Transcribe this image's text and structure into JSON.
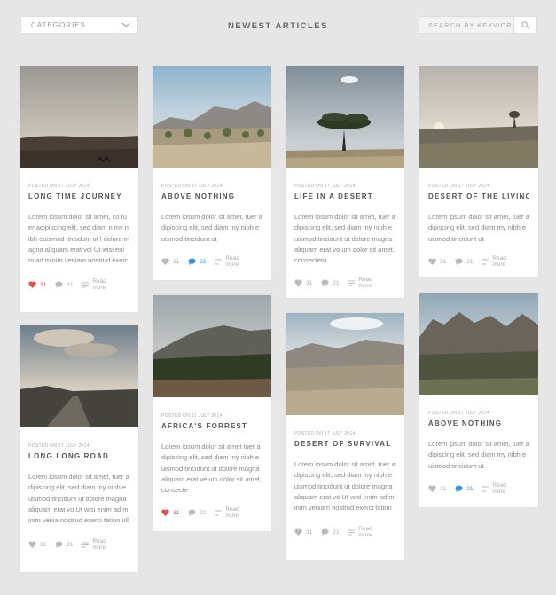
{
  "header": {
    "categories_label": "CATEGORIES",
    "title": "NEWEST ARTICLES",
    "search_placeholder": "SEARCH BY KEYWORDS"
  },
  "cards": [
    {
      "posted": "POSTED ON 17 JULY 2014",
      "title": "LONG TIME JOURNEY",
      "excerpt": "Lorem ipsum dolor sit amet, co tuer adipiscing elit, sed diam n my nibh euismod tincidunt ut l dolore magna aliquam erat vol Ut wisi enim ad minim veniam nostrud exerci tation ullamcor",
      "likes": "31",
      "comments": "21",
      "read_more": "Read more",
      "liked": true,
      "commented": false
    },
    {
      "posted": "POSTED ON 17 JULY 2014",
      "title": "ABOVE NOTHING",
      "excerpt": "Lorem ipsum dolor sit amet, tuer adipiscing elit, sed diam my nibh euismod tincidunt ut",
      "likes": "31",
      "comments": "21",
      "read_more": "Read more",
      "liked": false,
      "commented": true
    },
    {
      "posted": "POSTED ON 17 JULY 2014",
      "title": "LIFE IN A DESERT",
      "excerpt": "Lorem ipsum dolor sit amet, tuer adipiscing elit, sed diam my nibh euismod tincidunt ut dolore magna aliquam erat vo um dolor sit amet, consectetu",
      "likes": "31",
      "comments": "21",
      "read_more": "Read more",
      "liked": false,
      "commented": false
    },
    {
      "posted": "POSTED ON 17 JULY 2014",
      "title": "DESERT OF THE LIVINGS",
      "excerpt": "Lorem ipsum dolor sit amet, tuer adipiscing elit, sed diam my nibh euismod tincidunt ut",
      "likes": "31",
      "comments": "21",
      "read_more": "Read more",
      "liked": false,
      "commented": false
    },
    {
      "posted": "POSTED ON 17 JULY 2014",
      "title": "LONG LONG ROAD",
      "excerpt": "Lorem ipsum dolor sit amet, tuer adipiscing elit, sed diam my nibh euismod tincidunt ut dolore magna aliquam erat vo Ut wisi enim ad minim venia nostrud exerci tation ullamco",
      "likes": "31",
      "comments": "21",
      "read_more": "Read more",
      "liked": false,
      "commented": false
    },
    {
      "posted": "POSTED ON 17 JULY 2014",
      "title": "AFRICA'S FORREST",
      "excerpt": "Lorem ipsum dolor sit amet tuer adipiscing elit, sed diam my nibh euismod tincidunt ut dolore magna aliquam erat ve um dolor sit amet, consecte",
      "likes": "31",
      "comments": "21",
      "read_more": "Read more",
      "liked": true,
      "commented": false
    },
    {
      "posted": "POSTED ON 17 JULY 2014",
      "title": "DESERT OF SURVIVAL",
      "excerpt": "Lorem ipsum dolor sit amet, tuer adipiscing elit, sed diam my nibh euismod tincidunt ut dolore magna aliquam erat vo Ut wisi enim ad minim veniam nostrud exerci tation ullamco",
      "likes": "31",
      "comments": "21",
      "read_more": "Read more",
      "liked": false,
      "commented": false
    },
    {
      "posted": "POSTED ON 17 JULY 2014",
      "title": "ABOVE NOTHING",
      "excerpt": "Lorem ipsum dolor sit amet, tuer adipiscing elit, sed diam my nibh euismod tincidunt ut",
      "likes": "31",
      "comments": "21",
      "read_more": "Read more",
      "liked": false,
      "commented": true
    }
  ],
  "colors": {
    "background": "#e6e6e6",
    "card": "#ffffff",
    "like_active": "#d9534f",
    "comment_active": "#3b8fd6",
    "muted": "#aaaaaa"
  },
  "icons": [
    "chevron-down-icon",
    "search-icon",
    "heart-icon",
    "comment-icon",
    "read-more-icon"
  ]
}
